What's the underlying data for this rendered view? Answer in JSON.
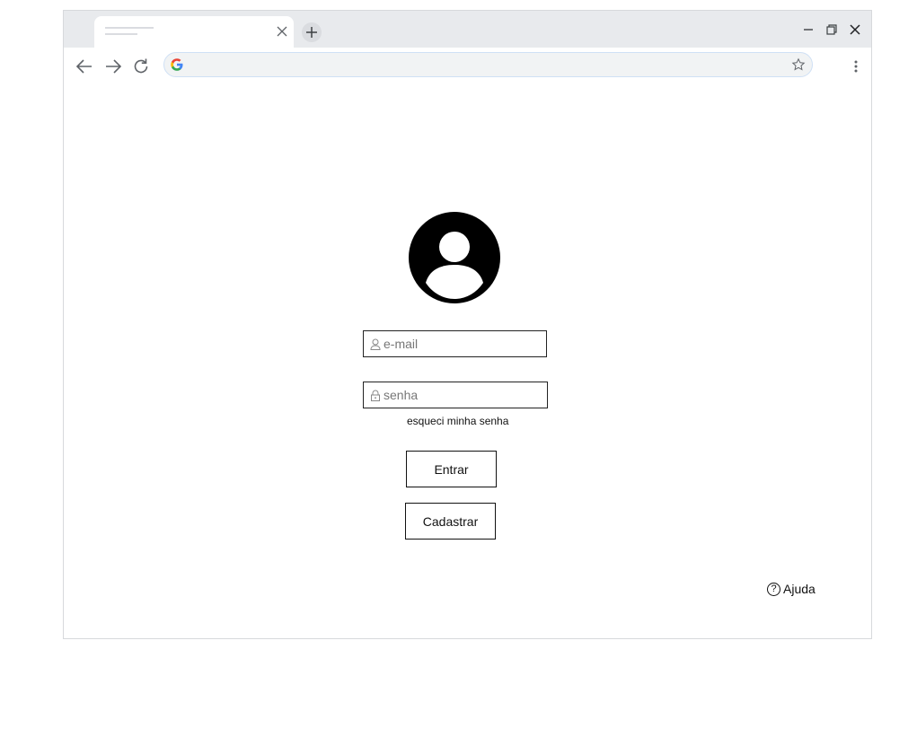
{
  "login": {
    "email_placeholder": "e-mail",
    "password_placeholder": "senha",
    "forgot_label": "esqueci minha senha",
    "enter_label": "Entrar",
    "register_label": "Cadastrar"
  },
  "help": {
    "icon_glyph": "?",
    "label": "Ajuda"
  },
  "icons": {
    "tab": "close-icon",
    "new_tab": "plus-icon",
    "window": [
      "minimize-icon",
      "restore-icon",
      "close-icon"
    ],
    "nav": [
      "back-arrow-icon",
      "forward-arrow-icon",
      "reload-icon"
    ],
    "omnibox": [
      "google-icon",
      "star-icon"
    ],
    "menu": "more-vert-icon",
    "avatar": "user-avatar-icon",
    "email": "user-icon",
    "password": "lock-icon"
  },
  "colors": {
    "tabstrip": "#e8eaed",
    "omnibox_bg": "#f1f3f4",
    "omnibox_border": "#cfe0f5",
    "text": "#111111"
  }
}
